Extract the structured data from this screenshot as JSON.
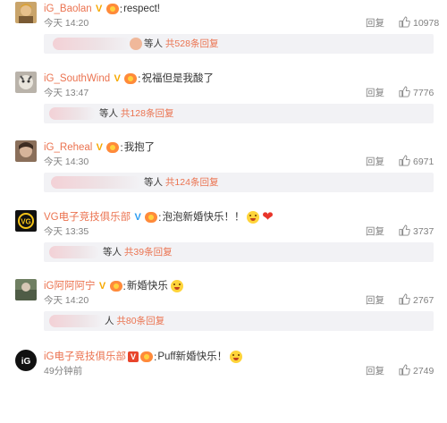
{
  "comments": [
    {
      "username": "iG_Baolan",
      "badge": "gold",
      "text": "respect!",
      "time": "今天 14:20",
      "reply_label": "回复",
      "likes": "10978",
      "replies_prefix": "等人",
      "replies_count": "共528条回复",
      "extra_emoji": "none"
    },
    {
      "username": "iG_SouthWind",
      "badge": "gold",
      "text": "祝福但是我酸了",
      "time": "今天 13:47",
      "reply_label": "回复",
      "likes": "7776",
      "replies_prefix": "等人",
      "replies_count": "共128条回复",
      "extra_emoji": "none"
    },
    {
      "username": "iG_Reheal",
      "badge": "gold",
      "text": "我抱了",
      "time": "今天 14:30",
      "reply_label": "回复",
      "likes": "6971",
      "replies_prefix": "等人",
      "replies_count": "共124条回复",
      "extra_emoji": "none"
    },
    {
      "username": "VG电子竞技俱乐部",
      "badge": "blue",
      "text": "泡泡新婚快乐！！",
      "time": "今天 13:35",
      "reply_label": "回复",
      "likes": "3737",
      "replies_prefix": "等人",
      "replies_count": "共39条回复",
      "extra_emoji": "shock-emoji + heart-emoji"
    },
    {
      "username": "iG阿阿阿宁",
      "badge": "gold",
      "text": "新婚快乐",
      "time": "今天 14:20",
      "reply_label": "回复",
      "likes": "2767",
      "replies_prefix": "人",
      "replies_count": "共80条回复",
      "extra_emoji": "tongue-emoji"
    },
    {
      "username": "iG电子竞技俱乐部",
      "badge": "red",
      "text": "Puff新婚快乐！",
      "time": "49分钟前",
      "reply_label": "回复",
      "likes": "2749",
      "replies_prefix": "",
      "replies_count": "",
      "extra_emoji": "shock-emoji"
    }
  ],
  "colors": {
    "username": "#eb7350",
    "text": "#333333",
    "meta": "#808080",
    "reply_bar": "#f2f2f5",
    "verified_gold": "#f6a800",
    "verified_blue": "#2b9cf2",
    "verified_red": "#e8452c"
  }
}
